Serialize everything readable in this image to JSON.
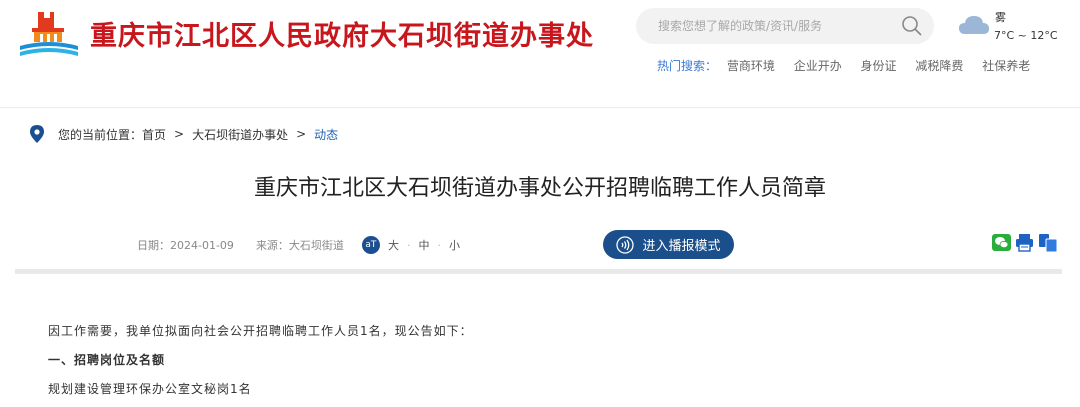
{
  "header": {
    "site_title": "重庆市江北区人民政府大石坝街道办事处",
    "search": {
      "placeholder": "搜索您想了解的政策/资讯/服务"
    },
    "weather": {
      "desc": "雾",
      "temp": "7°C ~ 12°C"
    },
    "hot_search": {
      "label": "热门搜索：",
      "items": [
        "营商环境",
        "企业开办",
        "身份证",
        "减税降费",
        "社保养老"
      ]
    }
  },
  "breadcrumb": {
    "prefix": "您的当前位置：",
    "items": [
      "首页",
      "大石坝街道办事处"
    ],
    "separator": ">",
    "current": "动态"
  },
  "article": {
    "title": "重庆市江北区大石坝街道办事处公开招聘临聘工作人员简章",
    "date": "日期：2024-01-09",
    "source": "来源：大石坝街道",
    "font_icon": "aT",
    "font_sizes": [
      "大",
      "中",
      "小"
    ],
    "broadcast_label": "进入播报模式",
    "paragraphs": [
      "因工作需要，我单位拟面向社会公开招聘临聘工作人员1名，现公告如下：",
      "一、招聘岗位及名额",
      "规划建设管理环保办公室文秘岗1名"
    ]
  },
  "icons": [
    "logo-icon",
    "search-icon",
    "cloud-icon",
    "location-pin-icon",
    "broadcast-icon",
    "wechat-icon",
    "print-icon",
    "copy-icon"
  ],
  "colors": {
    "brand_red": "#c8161d",
    "accent_blue": "#1a4f8b",
    "link_blue": "#3a7bd5"
  }
}
